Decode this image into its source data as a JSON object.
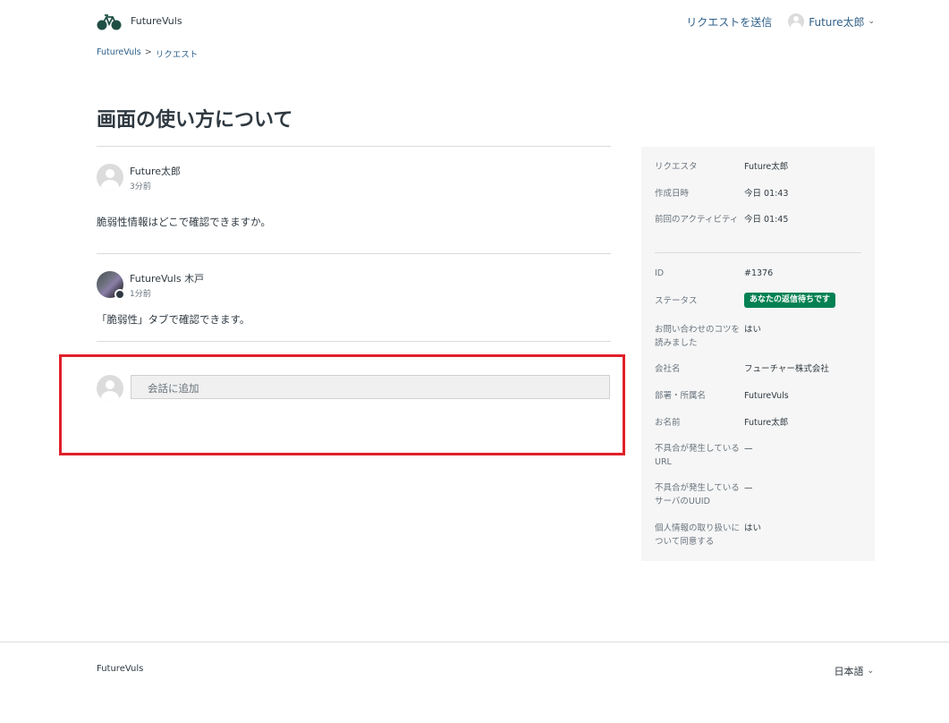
{
  "header": {
    "brand": "FutureVuls",
    "submit_request": "リクエストを送信",
    "user_name": "Future太郎"
  },
  "breadcrumb": {
    "home": "FutureVuls",
    "separator": ">",
    "current": "リクエスト"
  },
  "request": {
    "title": "画面の使い方について"
  },
  "comments": [
    {
      "author": "Future太郎",
      "time": "3分前",
      "body": "脆弱性情報はどこで確認できますか。"
    },
    {
      "author": "FutureVuls 木戸",
      "time": "1分前",
      "body": "「脆弱性」タブで確認できます。"
    }
  ],
  "reply": {
    "placeholder": "会話に追加"
  },
  "sidebar": {
    "top": [
      {
        "label": "リクエスタ",
        "value": "Future太郎"
      },
      {
        "label": "作成日時",
        "value": "今日 01:43"
      },
      {
        "label": "前回のアクティビティ",
        "value": "今日 01:45"
      }
    ],
    "id": {
      "label": "ID",
      "value": "#1376"
    },
    "status": {
      "label": "ステータス",
      "value": "あなたの返信待ちです"
    },
    "fields": [
      {
        "label": "お問い合わせのコツを読みました",
        "value": "はい"
      },
      {
        "label": "会社名",
        "value": "フューチャー株式会社"
      },
      {
        "label": "部署・所属名",
        "value": "FutureVuls"
      },
      {
        "label": "お名前",
        "value": "Future太郎"
      },
      {
        "label": "不具合が発生しているURL",
        "value": "—"
      },
      {
        "label": "不具合が発生しているサーバのUUID",
        "value": "—"
      },
      {
        "label": "個人情報の取り扱いについて同意する",
        "value": "はい"
      }
    ]
  },
  "footer": {
    "brand": "FutureVuls",
    "language": "日本語"
  },
  "colors": {
    "status_badge": "#038153",
    "highlight_border": "#e0202a",
    "link": "#2c5f8a"
  }
}
